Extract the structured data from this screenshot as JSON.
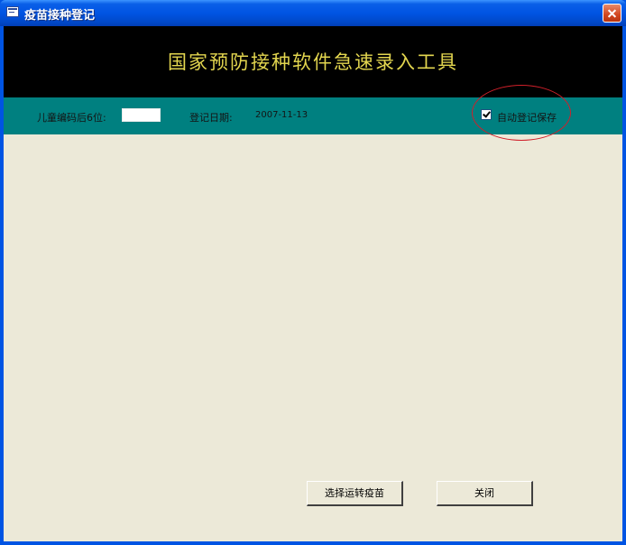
{
  "window": {
    "title": "疫苗接种登记"
  },
  "banner": {
    "title": "国家预防接种软件急速录入工具"
  },
  "infobar": {
    "child_code_label": "儿童编码后6位:",
    "child_code_value": "",
    "reg_date_label": "登记日期:",
    "reg_date_value": "2007-11-13",
    "auto_save_label": "自动登记保存",
    "auto_save_checked": true
  },
  "buttons": {
    "select_vaccine": "选择运转疫苗",
    "close": "关闭"
  },
  "colors": {
    "titlebar": "#0054e3",
    "banner_bg": "#000000",
    "banner_text": "#e3d64f",
    "infobar_bg": "#008080",
    "client_bg": "#ece9d8",
    "highlight": "#d0202a"
  },
  "icons": {
    "app": "form-window-icon",
    "close": "close-icon",
    "check": "checkmark-icon"
  }
}
